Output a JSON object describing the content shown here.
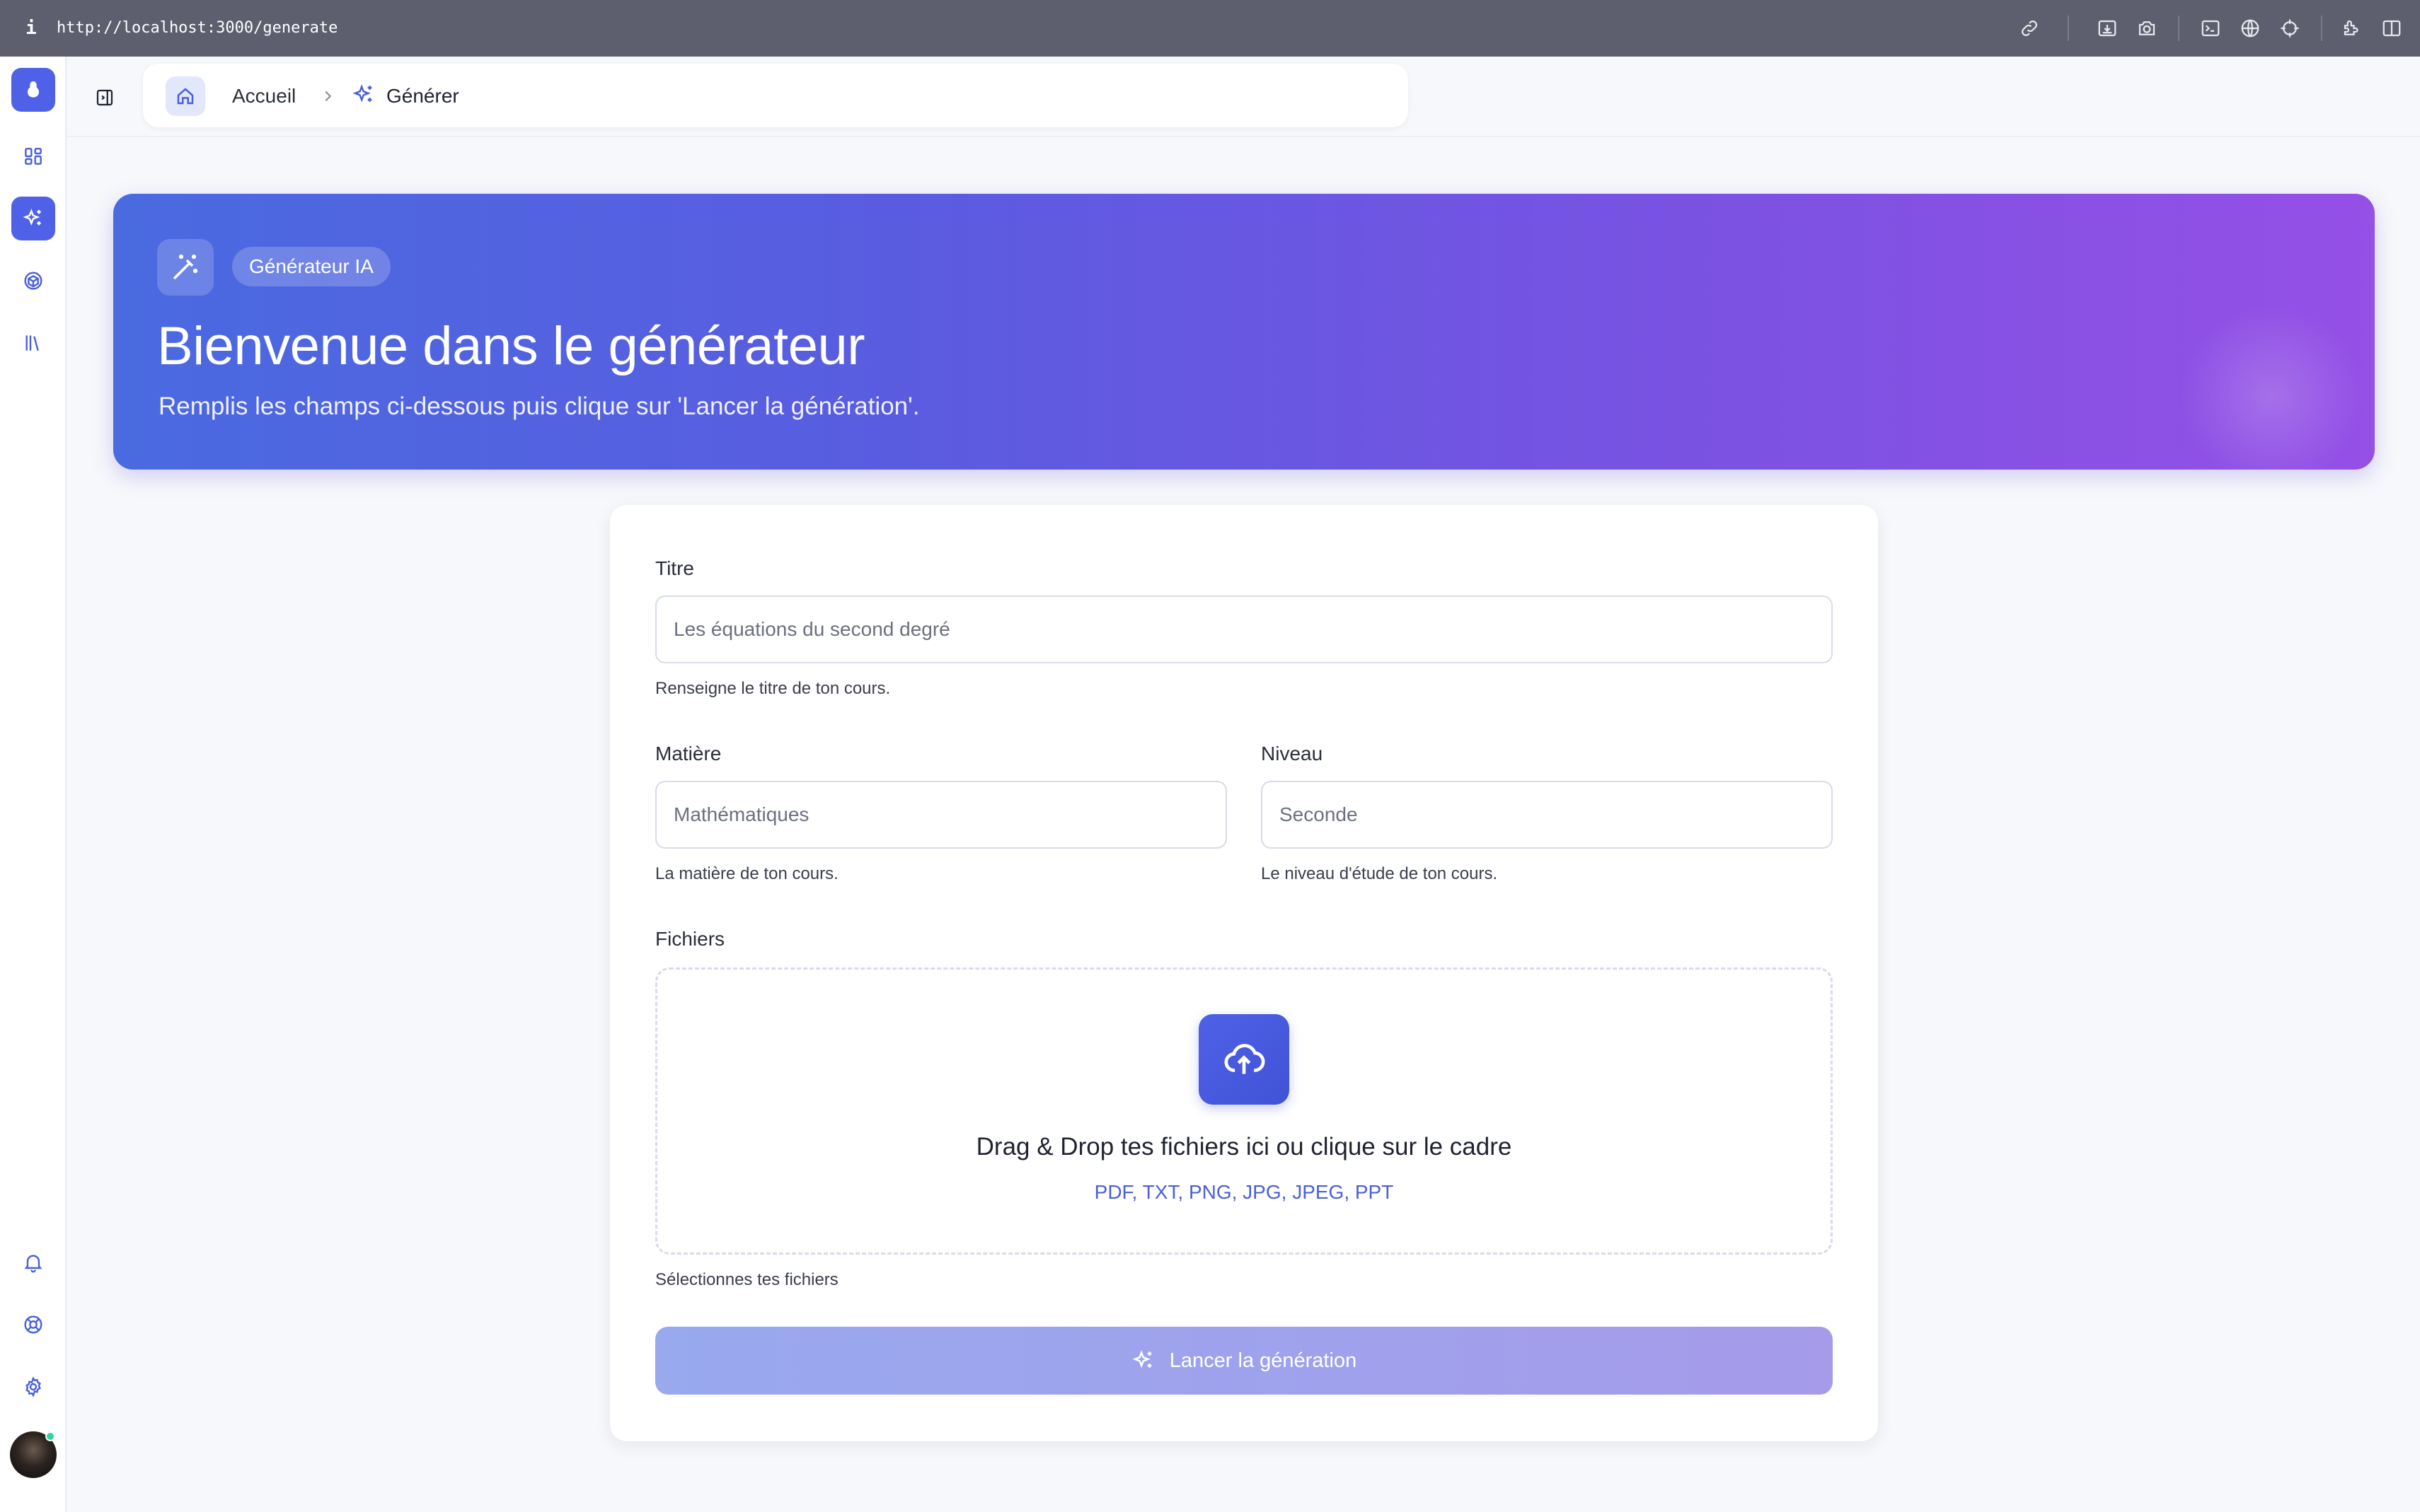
{
  "browser": {
    "info_icon": "i",
    "url": "http://localhost:3000/generate",
    "toolbar_icons": [
      "link-icon",
      "download-icon",
      "camera-icon",
      "terminal-icon",
      "globe-icon",
      "crosshair-icon",
      "extension-icon",
      "split-view-icon"
    ]
  },
  "sidebar": {
    "items": [
      "logo-icon",
      "dashboard-icon",
      "sparkles-icon",
      "cube-icon",
      "library-icon"
    ],
    "bottom_items": [
      "bell-icon",
      "help-buoy-icon",
      "gear-icon"
    ],
    "active_item": "sparkles-icon"
  },
  "breadcrumb": {
    "home": "Accueil",
    "current": "Générer"
  },
  "hero": {
    "badge": "Générateur IA",
    "title": "Bienvenue dans le générateur",
    "subtitle": "Remplis les champs ci-dessous puis clique sur 'Lancer la génération'."
  },
  "form": {
    "title_label": "Titre",
    "title_placeholder": "Les équations du second degré",
    "title_help": "Renseigne le titre de ton cours.",
    "subject_label": "Matière",
    "subject_placeholder": "Mathématiques",
    "subject_help": "La matière de ton cours.",
    "level_label": "Niveau",
    "level_placeholder": "Seconde",
    "level_help": "Le niveau d'étude de ton cours.",
    "files_label": "Fichiers",
    "dropzone_text": "Drag & Drop tes fichiers ici ou clique sur le cadre",
    "dropzone_types": "PDF, TXT, PNG, JPG, JPEG, PPT",
    "files_help": "Sélectionnes tes fichiers",
    "submit_label": "Lancer la génération"
  },
  "colors": {
    "accent": "#4f61e6",
    "hero_start": "#4a6ae0",
    "hero_end": "#9550e6"
  }
}
